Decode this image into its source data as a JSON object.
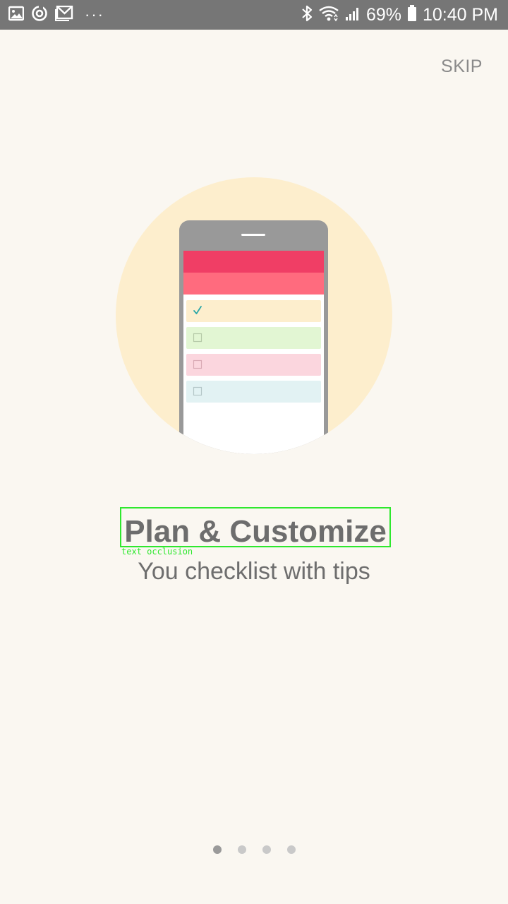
{
  "status_bar": {
    "battery": "69%",
    "time": "10:40 PM",
    "dots": "···",
    "icons": [
      "gallery-icon",
      "sync-icon",
      "gmail-icon",
      "bluetooth-icon",
      "wifi-icon",
      "signal-icon",
      "battery-icon"
    ]
  },
  "header": {
    "skip_label": "SKIP"
  },
  "onboarding": {
    "title": "Plan & Customize",
    "subtitle": "You checklist with tips",
    "annotation_label": "text occlusion"
  },
  "pager": {
    "count": 4,
    "active_index": 0
  },
  "colors": {
    "background": "#faf7f1",
    "status_bar": "#767676",
    "circle": "#fdeecd",
    "header_dark": "#f03e65",
    "header_light": "#ff6b7e",
    "item_yellow": "#fdeecd",
    "item_green": "#e2f6d3",
    "item_pink": "#fbd6de",
    "item_blue": "#e2f2f3",
    "check": "#2aa7a7",
    "annotation": "#2ee82e"
  }
}
